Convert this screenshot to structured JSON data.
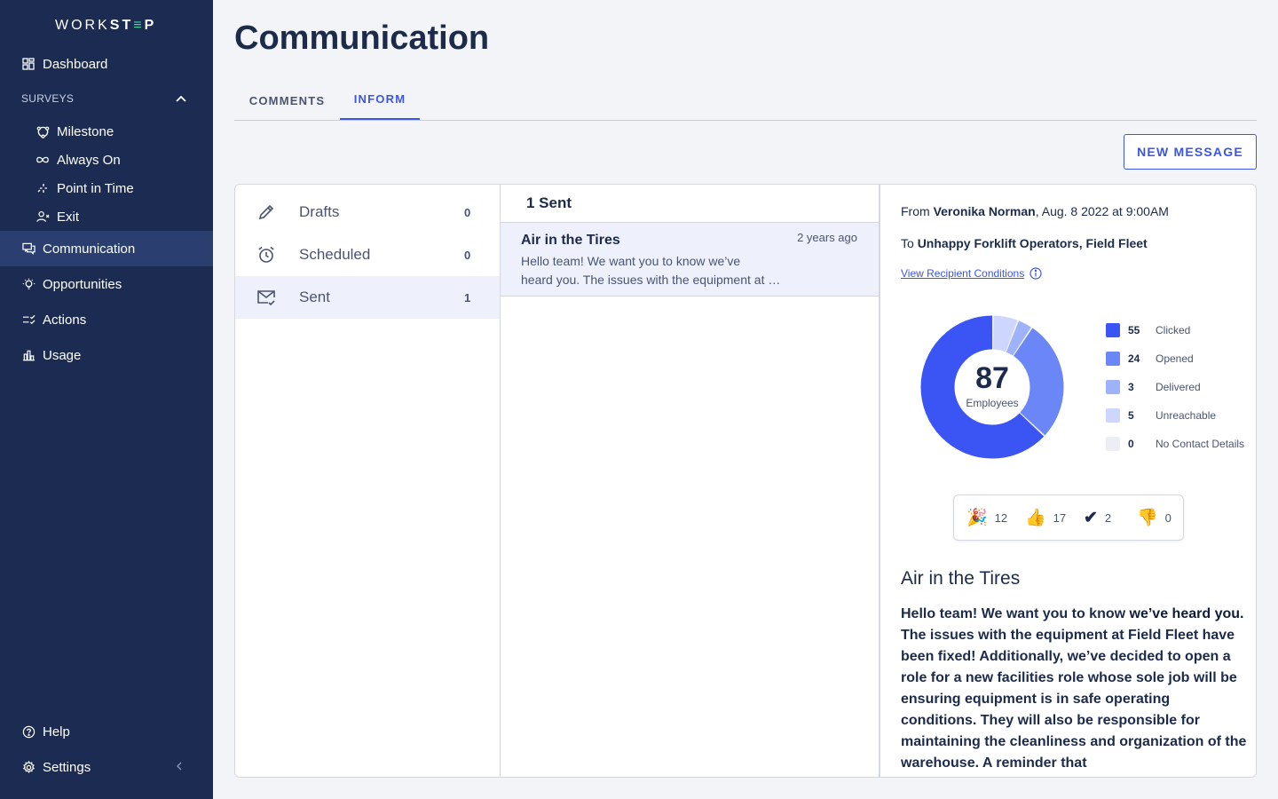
{
  "app": {
    "logo_part1": "WORK",
    "logo_part2": "ST",
    "logo_part3": "≡",
    "logo_part4": "P"
  },
  "sidebar": {
    "dashboard": "Dashboard",
    "surveys_label": "SURVEYS",
    "surveys": [
      {
        "label": "Milestone",
        "icon": "milestone-icon"
      },
      {
        "label": "Always On",
        "icon": "infinity-icon"
      },
      {
        "label": "Point in Time",
        "icon": "sparkle-icon"
      },
      {
        "label": "Exit",
        "icon": "user-x-icon"
      }
    ],
    "communication": "Communication",
    "opportunities": "Opportunities",
    "actions": "Actions",
    "usage": "Usage",
    "help": "Help",
    "settings": "Settings"
  },
  "page": {
    "title": "Communication",
    "tabs": [
      {
        "label": "COMMENTS",
        "active": false
      },
      {
        "label": "INFORM",
        "active": true
      }
    ],
    "new_message_label": "NEW MESSAGE"
  },
  "folders": [
    {
      "label": "Drafts",
      "count": "0",
      "icon": "pencil-icon"
    },
    {
      "label": "Scheduled",
      "count": "0",
      "icon": "alarm-clock-icon"
    },
    {
      "label": "Sent",
      "count": "1",
      "icon": "mail-check-icon"
    }
  ],
  "message_list": {
    "header": "1 Sent",
    "items": [
      {
        "title": "Air in the Tires",
        "time": "2 years ago",
        "preview_line1": "Hello team! We want you to know we’ve",
        "preview_line2": "heard you. The issues with the equipment at Field Fleet"
      }
    ]
  },
  "detail": {
    "from_prefix": "From ",
    "from_name": "Veronika Norman",
    "from_date": ", Aug. 8 2022 at 9:00AM",
    "to_prefix": "To ",
    "to_recipients": "Unhappy Forklift Operators, Field Fleet",
    "view_conditions": "View Recipient Conditions",
    "total": "87",
    "total_label": "Employees",
    "stats": [
      {
        "value": 55,
        "label": "Clicked",
        "color": "#3b55f5"
      },
      {
        "value": 24,
        "label": "Opened",
        "color": "#6b86f7"
      },
      {
        "value": 3,
        "label": "Delivered",
        "color": "#9eb2fa"
      },
      {
        "value": 5,
        "label": "Unreachable",
        "color": "#cdd6fc"
      },
      {
        "value": 0,
        "label": "No Contact Details",
        "color": "#eceef3"
      }
    ],
    "reactions": [
      {
        "emoji": "🎉",
        "count": "12",
        "icon": "party-popper-icon"
      },
      {
        "emoji": "👍",
        "count": "17",
        "icon": "thumbs-up-icon"
      },
      {
        "emoji": "✔",
        "count": "2",
        "icon": "check-mark-icon"
      },
      {
        "emoji": "👎",
        "count": "0",
        "icon": "thumbs-down-icon"
      }
    ],
    "title": "Air in the Tires",
    "body_part1": "Hello team! We want you to know ",
    "body_strong": "we’ve heard you.",
    "body_part2": " The issues with the equipment at Field Fleet have been fixed! Additionally, we’ve decided to open a role for a new facilities role whose sole job will be ensuring equipment is in safe operating conditions. They will also be responsible for maintaining the cleanliness and organization of the warehouse. A reminder that"
  }
}
